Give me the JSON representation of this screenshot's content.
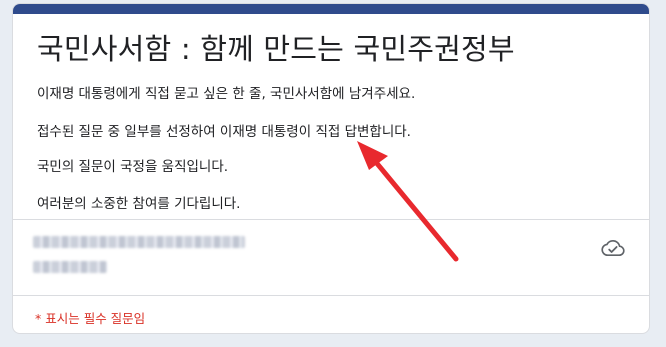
{
  "form": {
    "title": "국민사서함 : 함께 만드는 국민주권정부",
    "description": [
      "이재명 대통령에게 직접 묻고 싶은 한 줄, 국민사서함에 남겨주세요.",
      "접수된 질문 중 일부를 선정하여 이재명 대통령이 직접 답변합니다.",
      "국민의 질문이 국정을 움직입니다.",
      "여러분의 소중한 참여를 기다립니다."
    ],
    "required_note": "* 표시는 필수 질문임",
    "save_status_icon": "cloud-check-icon"
  },
  "colors": {
    "accent_bar": "#2f4b8c",
    "required_text": "#d93025",
    "annotation_arrow": "#e8292e"
  }
}
